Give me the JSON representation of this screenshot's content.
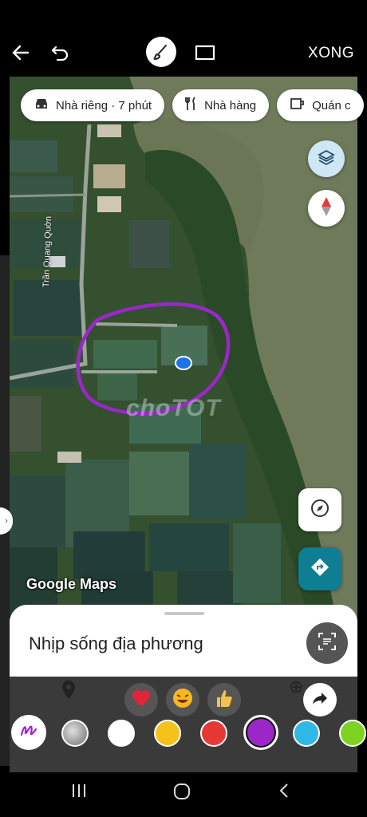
{
  "editor": {
    "done_label": "XONG"
  },
  "map": {
    "chips": [
      {
        "label": "Nhà riêng · 7 phút",
        "icon": "car-icon"
      },
      {
        "label": "Nhà hàng",
        "icon": "restaurant-icon"
      },
      {
        "label": "Quán c",
        "icon": "coffee-icon"
      }
    ],
    "road_label": "Trần Quang Quờn",
    "attribution": "Google Maps",
    "watermark": "choTOT",
    "location_dot_color": "#1a73e8",
    "drawn_circle_color": "#9b27c9"
  },
  "sheet": {
    "title": "Nhịp sống địa phương"
  },
  "reactions": [
    "heart-emoji",
    "laughing-emoji",
    "thumbs-up-emoji"
  ],
  "palette": {
    "colors": [
      "#9e9e9e",
      "#ffffff",
      "#f4c21b",
      "#e53935",
      "#9b27c9",
      "#2fb7e6",
      "#7ed321"
    ],
    "selected_color": "#9b27c9"
  }
}
